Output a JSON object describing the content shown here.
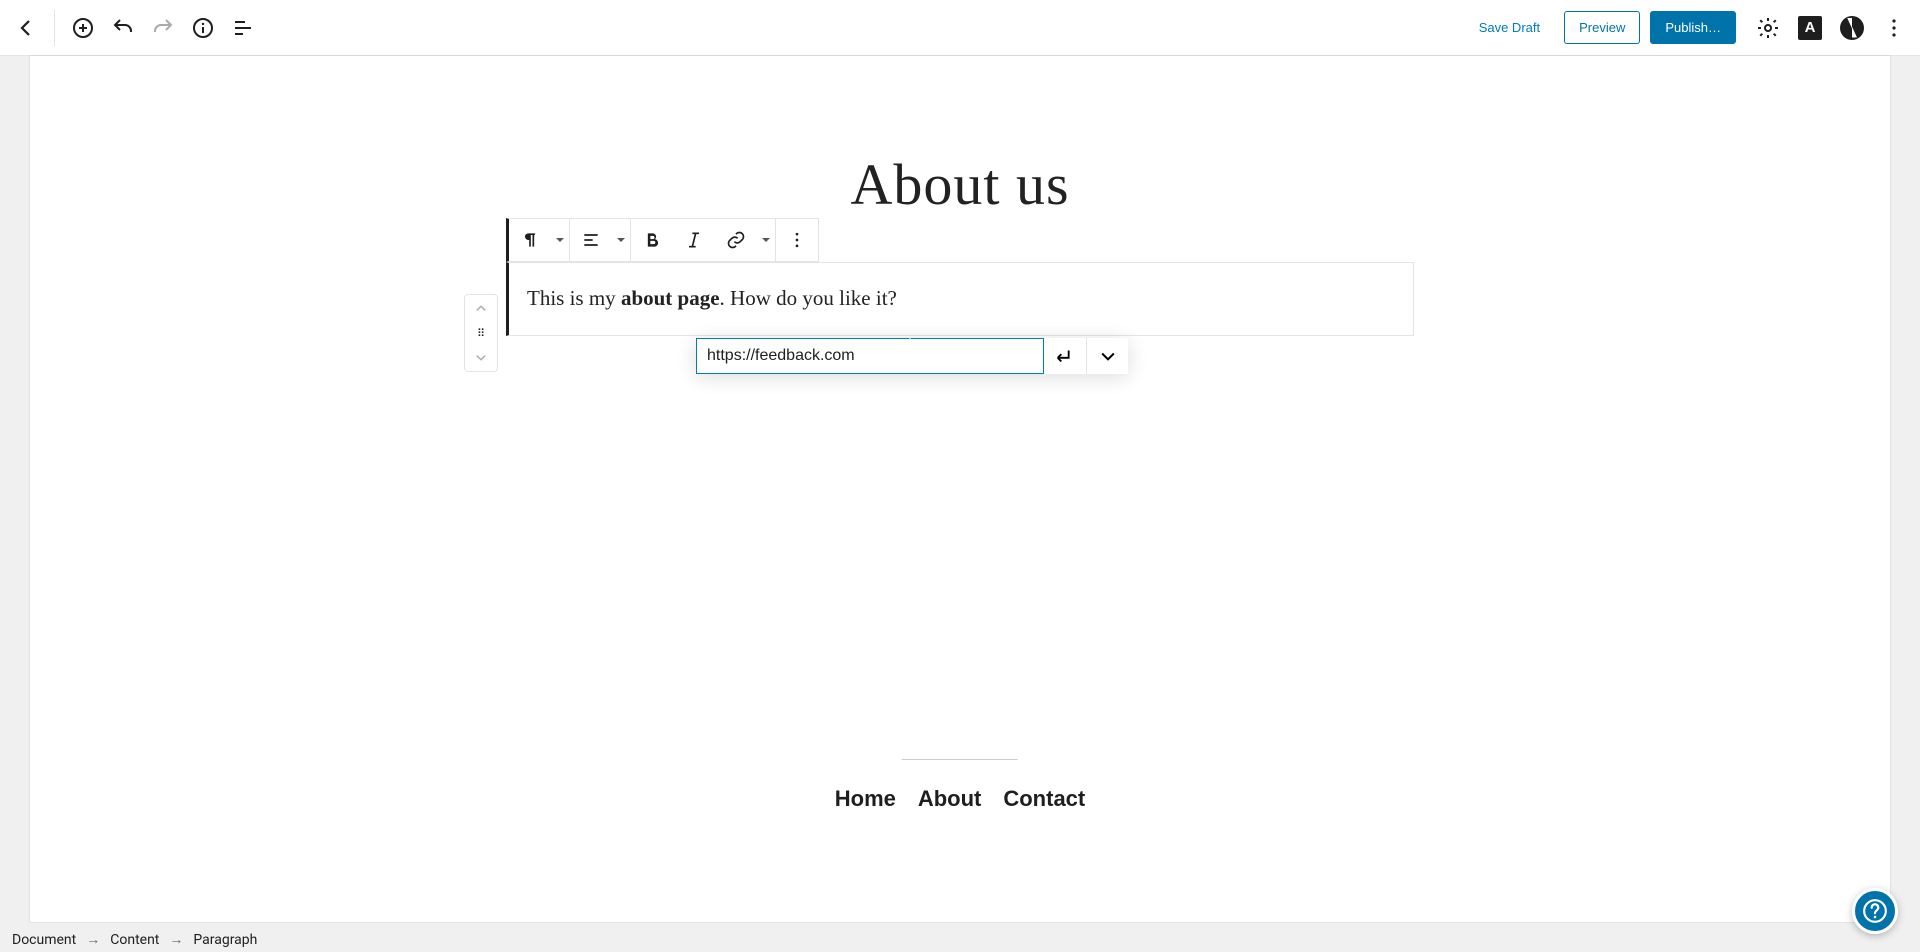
{
  "header": {
    "save_draft_label": "Save Draft",
    "preview_label": "Preview",
    "publish_label": "Publish…"
  },
  "page": {
    "title": "About us",
    "paragraph_prefix": "This is my ",
    "paragraph_bold": "about page",
    "paragraph_suffix": ". How do you like it?"
  },
  "link_popover": {
    "url_value": "https://feedback.com"
  },
  "footer_nav": {
    "items": [
      "Home",
      "About",
      "Contact"
    ]
  },
  "breadcrumb": {
    "items": [
      "Document",
      "Content",
      "Paragraph"
    ]
  },
  "icons": {
    "accessibility_letter": "A"
  }
}
